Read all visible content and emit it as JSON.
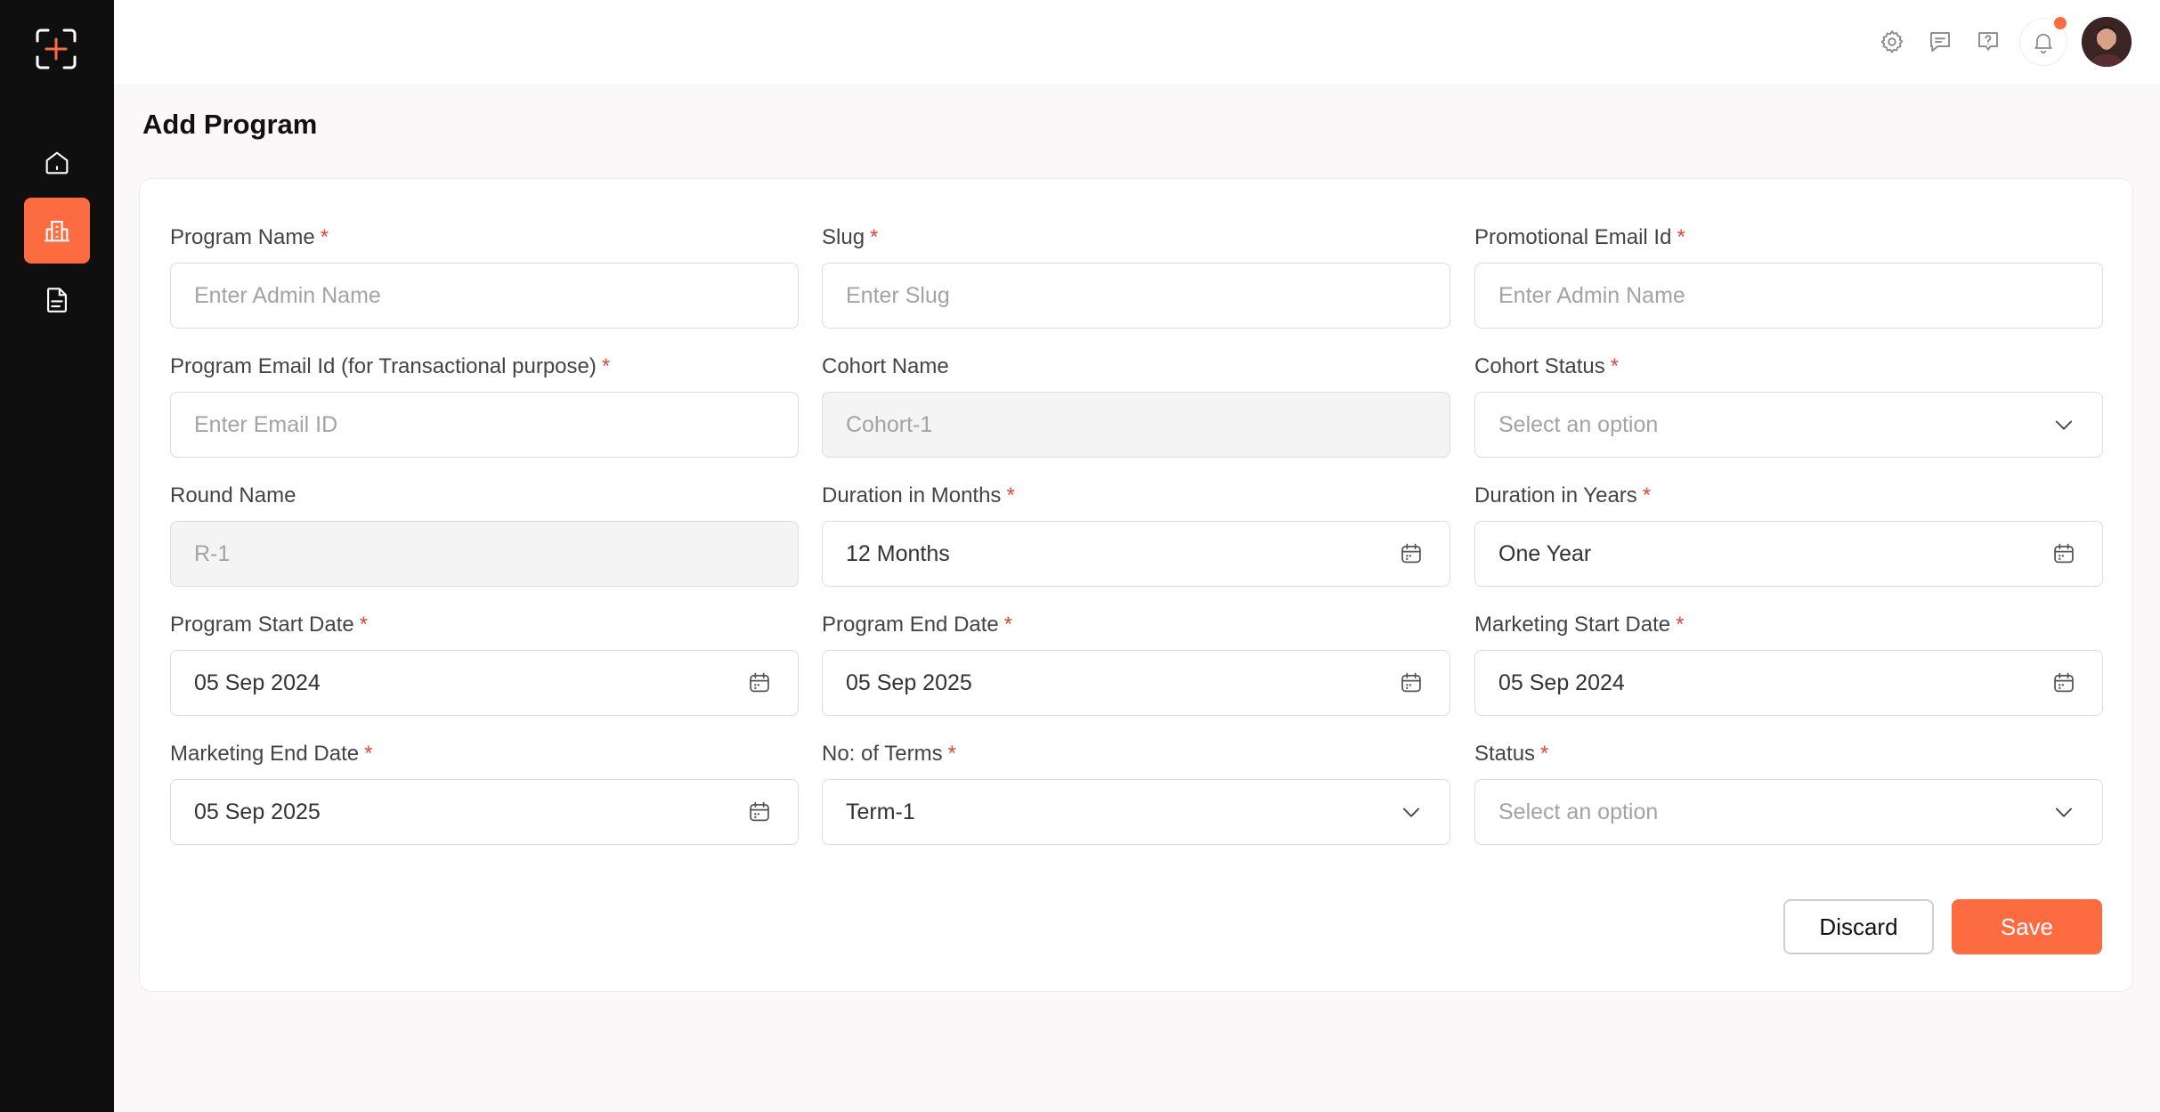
{
  "page": {
    "title": "Add Program"
  },
  "form": {
    "fields": [
      {
        "label": "Program Name",
        "required": "*",
        "placeholder": "Enter Admin Name",
        "value": ""
      },
      {
        "label": "Slug",
        "required": "*",
        "placeholder": "Enter Slug",
        "value": ""
      },
      {
        "label": "Promotional Email Id",
        "required": "*",
        "placeholder": "Enter Admin Name",
        "value": ""
      },
      {
        "label": "Program Email Id (for Transactional purpose)",
        "required": "*",
        "placeholder": "Enter Email ID",
        "value": ""
      },
      {
        "label": "Cohort Name",
        "required": "",
        "placeholder": "Cohort-1",
        "value": ""
      },
      {
        "label": "Cohort Status",
        "required": "*",
        "placeholder": "Select an option",
        "value": ""
      },
      {
        "label": "Round Name",
        "required": "",
        "placeholder": "R-1",
        "value": ""
      },
      {
        "label": "Duration in Months",
        "required": "*",
        "placeholder": "",
        "value": "12 Months"
      },
      {
        "label": "Duration in Years",
        "required": "*",
        "placeholder": "",
        "value": "One Year"
      },
      {
        "label": "Program Start Date",
        "required": "*",
        "placeholder": "",
        "value": "05 Sep 2024"
      },
      {
        "label": "Program End Date",
        "required": "*",
        "placeholder": "",
        "value": "05 Sep 2025"
      },
      {
        "label": "Marketing Start Date",
        "required": "*",
        "placeholder": "",
        "value": "05 Sep 2024"
      },
      {
        "label": "Marketing End Date",
        "required": "*",
        "placeholder": "",
        "value": "05 Sep 2025"
      },
      {
        "label": "No: of Terms",
        "required": "*",
        "placeholder": "",
        "value": "Term-1"
      },
      {
        "label": "Status",
        "required": "*",
        "placeholder": "Select an option",
        "value": ""
      }
    ],
    "discard_label": "Discard",
    "save_label": "Save"
  },
  "icons": {
    "sidebar": [
      "home-icon",
      "building-icon",
      "document-icon"
    ],
    "topbar": [
      "settings-icon",
      "message-icon",
      "help-icon",
      "bell-icon"
    ]
  },
  "colors": {
    "accent": "#fd6b41",
    "sidebar_bg": "#0f0f0f",
    "required": "#e4473b"
  }
}
